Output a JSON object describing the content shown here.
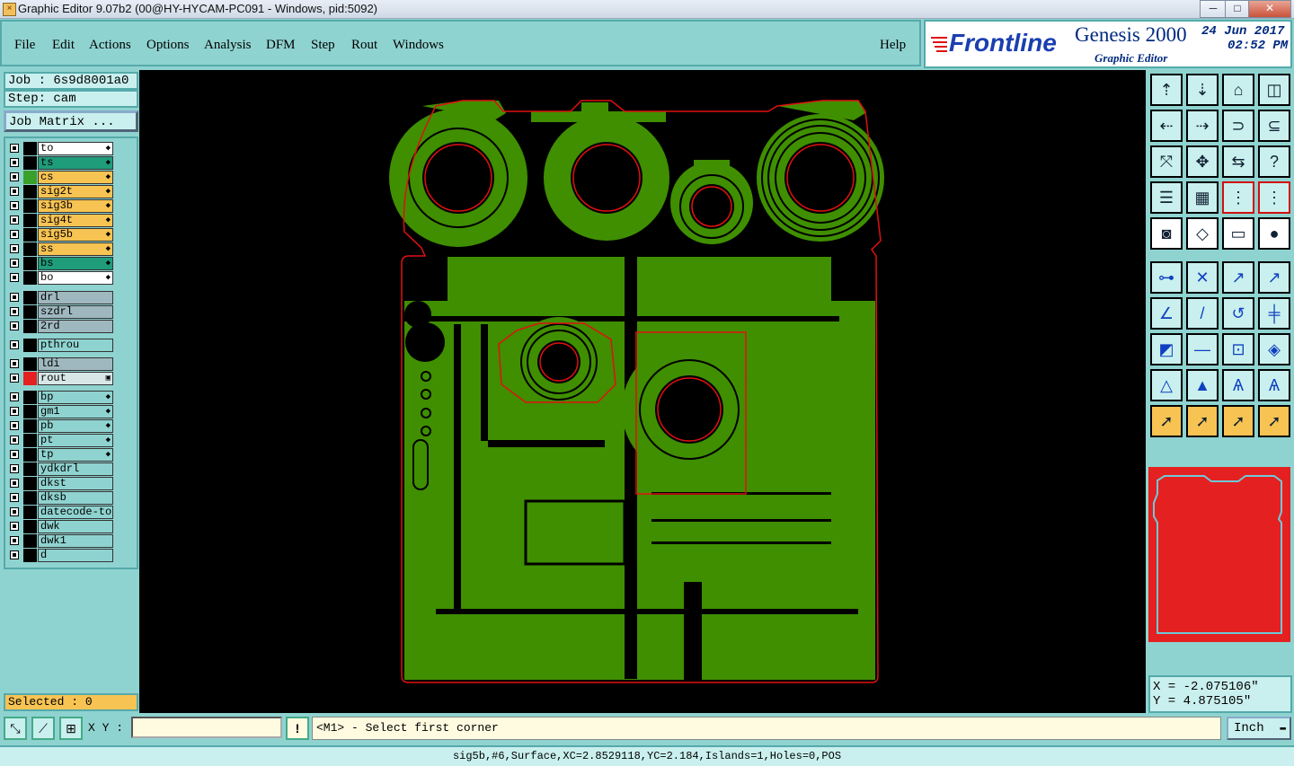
{
  "window": {
    "title": "Graphic Editor 9.07b2 (00@HY-HYCAM-PC091 - Windows, pid:5092)",
    "min": "─",
    "max": "□",
    "close": "✕"
  },
  "menu": [
    "File",
    "Edit",
    "Actions",
    "Options",
    "Analysis",
    "DFM",
    "Step",
    "Rout",
    "Windows"
  ],
  "help_label": "Help",
  "logo": {
    "brand": "Frontline",
    "product": "Genesis 2000",
    "subtitle": "Graphic Editor",
    "date": "24 Jun 2017",
    "time": "02:52 PM"
  },
  "job": "Job : 6s9d8001a0",
  "step": "Step: cam",
  "job_matrix_label": "Job Matrix ...",
  "layers": [
    {
      "name": "to",
      "color": "#ffffff",
      "swatch": "#000000",
      "icon": "◆"
    },
    {
      "name": "ts",
      "color": "#1f9c7a",
      "swatch": "#000000",
      "icon": "◆"
    },
    {
      "name": "cs",
      "color": "#f7c352",
      "swatch": "#3aa02a",
      "icon": "◆"
    },
    {
      "name": "sig2t",
      "color": "#f7c352",
      "swatch": "#000000",
      "icon": "◆"
    },
    {
      "name": "sig3b",
      "color": "#f7c352",
      "swatch": "#000000",
      "icon": "◆"
    },
    {
      "name": "sig4t",
      "color": "#f7c352",
      "swatch": "#000000",
      "icon": "◆"
    },
    {
      "name": "sig5b",
      "color": "#f7c352",
      "swatch": "#000000",
      "icon": "◆"
    },
    {
      "name": "ss",
      "color": "#f7c352",
      "swatch": "#000000",
      "icon": "◆"
    },
    {
      "name": "bs",
      "color": "#1f9c7a",
      "swatch": "#000000",
      "icon": "◆"
    },
    {
      "name": "bo",
      "color": "#ffffff",
      "swatch": "#000000",
      "icon": "◆"
    },
    {
      "name": "drl",
      "color": "#9fb8bf",
      "swatch": "#000000",
      "icon": ""
    },
    {
      "name": "szdrl",
      "color": "#9fb8bf",
      "swatch": "#000000",
      "icon": ""
    },
    {
      "name": "2rd",
      "color": "#9fb8bf",
      "swatch": "#000000",
      "icon": ""
    },
    {
      "name": "pthrou",
      "color": "#8fd3d0",
      "swatch": "#000000",
      "icon": ""
    },
    {
      "name": "ldi",
      "color": "#9fb8bf",
      "swatch": "#000000",
      "icon": ""
    },
    {
      "name": "rout",
      "color": "#d8e6e6",
      "swatch": "#e52020",
      "icon": "▣"
    },
    {
      "name": "bp",
      "color": "#8fd3d0",
      "swatch": "#000000",
      "icon": "◆"
    },
    {
      "name": "gm1",
      "color": "#8fd3d0",
      "swatch": "#000000",
      "icon": "◆"
    },
    {
      "name": "pb",
      "color": "#8fd3d0",
      "swatch": "#000000",
      "icon": "◆"
    },
    {
      "name": "pt",
      "color": "#8fd3d0",
      "swatch": "#000000",
      "icon": "◆"
    },
    {
      "name": "tp",
      "color": "#8fd3d0",
      "swatch": "#000000",
      "icon": "◆"
    },
    {
      "name": "ydkdrl",
      "color": "#8fd3d0",
      "swatch": "#000000",
      "icon": ""
    },
    {
      "name": "dkst",
      "color": "#8fd3d0",
      "swatch": "#000000",
      "icon": ""
    },
    {
      "name": "dksb",
      "color": "#8fd3d0",
      "swatch": "#000000",
      "icon": ""
    },
    {
      "name": "datecode-to",
      "color": "#8fd3d0",
      "swatch": "#000000",
      "icon": ""
    },
    {
      "name": "dwk",
      "color": "#8fd3d0",
      "swatch": "#000000",
      "icon": ""
    },
    {
      "name": "dwk1",
      "color": "#8fd3d0",
      "swatch": "#000000",
      "icon": ""
    },
    {
      "name": "d",
      "color": "#8fd3d0",
      "swatch": "#000000",
      "icon": ""
    }
  ],
  "selected": "Selected : 0",
  "coords": {
    "x": "X = -2.075106\"",
    "y": "Y = 4.875105\""
  },
  "xy_label": "X Y :",
  "xy_value": "",
  "prompt": "<M1> - Select first corner",
  "units": "Inch",
  "status": "sig5b,#6,Surface,XC=2.8529118,YC=2.184,Islands=1,Holes=0,POS",
  "colors": {
    "board_green": "#3f8f00",
    "rout_red": "#e01010",
    "panel": "#8fd3d0",
    "highlight": "#f7c352"
  }
}
